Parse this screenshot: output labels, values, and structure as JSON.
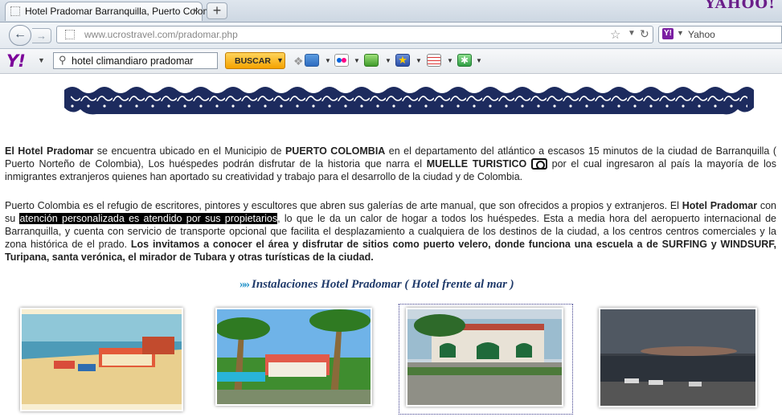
{
  "browser": {
    "tab_title": "Hotel Pradomar Barranquilla, Puerto Colombi...",
    "tab_close": "×",
    "new_tab": "+",
    "brand_corner": "YAHOO!",
    "url_domain": "www.ucrostravel.com",
    "url_path": "/pradomar.php",
    "search_engine": "Yahoo"
  },
  "yahoo_toolbar": {
    "logo": "Y!",
    "search_value": "hotel climandiaro pradomar",
    "search_button": "BUSCAR",
    "icons": [
      "mail-icon",
      "flickr-icon",
      "games-icon",
      "favorites-star-icon",
      "calendar-icon",
      "addons-icon"
    ]
  },
  "content": {
    "p1": {
      "s1": "El Hotel Pradomar",
      "s2": " se encuentra ubicado en el Municipio de ",
      "s3": "PUERTO COLOMBIA",
      "s4": " en el departamento del atlántico a escasos 15 minutos de la ciudad de Barranquilla ( Puerto Norteño de Colombia),  Los huéspedes podrán disfrutar de la historia que narra el ",
      "s5": "MUELLE TURISTICO",
      "s6": " por el cual ingresaron al país la mayoría de los inmigrantes extranjeros quienes han aportado su creatividad y trabajo para el desarrollo de la ciudad y de Colombia."
    },
    "p2": {
      "s1": "Puerto Colombia es el refugio de escritores, pintores y escultores que abren sus galerías de arte manual, que son ofrecidos a propios y extranjeros. El ",
      "s2": "Hotel Pradomar",
      "s3": " con su ",
      "s4": "atención personalizada  es atendido por sus propietarios",
      "s5": ", lo que le da un calor de hogar a todos los  huéspedes.        Esta a media hora del aeropuerto internacional de Barranquilla, y cuenta con servicio de transporte opcional  que facilita el desplazamiento a cualquiera de los destinos de la ciudad, a  los centros  centros comerciales y la zona histórica de el prado.   ",
      "s6": "Los invitamos a conocer el área y disfrutar de sitios como puerto velero, donde funciona una escuela a de SURFING y WINDSURF, Turipana, santa verónica, el mirador de Tubara y otras turísticas de la ciudad."
    },
    "section_arrow": "»»",
    "section_title": "Instalaciones Hotel Pradomar ( Hotel frente al mar )",
    "photos": [
      {
        "name": "postcard-beach-photo"
      },
      {
        "name": "pool-palms-photo"
      },
      {
        "name": "hotel-entrance-photo"
      },
      {
        "name": "sunset-terrace-photo"
      }
    ]
  },
  "colors": {
    "wave_navy": "#1d2b5e",
    "buscar_orange": "#f5a300",
    "yahoo_purple": "#7b0099",
    "title_blue": "#1f3a6a"
  }
}
